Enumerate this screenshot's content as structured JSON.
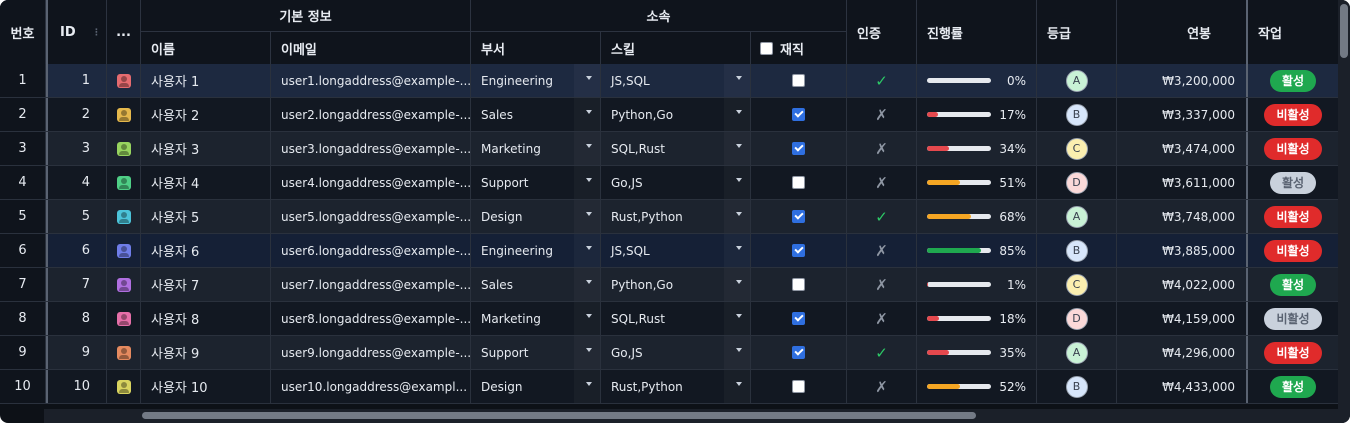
{
  "header": {
    "row_no": "번호",
    "id": "ID",
    "avatar": "...",
    "group_basic": "기본 정보",
    "name": "이름",
    "email": "이메일",
    "group_org": "소속",
    "dept": "부서",
    "skills": "스킬",
    "employed": "재직",
    "verified": "인증",
    "progress": "진행률",
    "grade": "등급",
    "salary": "연봉",
    "actions": "작업"
  },
  "colors": {
    "progress_low": "#e5484d",
    "progress_mid": "#f5a623",
    "progress_high": "#1fa84f",
    "badge_active": "#1fa84f",
    "badge_inactive": "#e02b2b",
    "badge_neutral": "#c9d1dc"
  },
  "rows": [
    {
      "no": "1",
      "id": "1",
      "avatar_color": "#e56b6f",
      "name": "사용자 1",
      "email": "user1.longaddress@example-...",
      "dept": "Engineering",
      "skills": "JS,SQL",
      "employed": false,
      "verified": true,
      "verified_mark": "✓",
      "progress": 0,
      "progress_label": "0%",
      "grade": "A",
      "grade_color": "#c9f2d6",
      "salary": "₩3,200,000",
      "status": "활성",
      "status_type": "active"
    },
    {
      "no": "2",
      "id": "2",
      "avatar_color": "#e5b84c",
      "name": "사용자 2",
      "email": "user2.longaddress@example-...",
      "dept": "Sales",
      "skills": "Python,Go",
      "employed": true,
      "verified": false,
      "verified_mark": "✗",
      "progress": 17,
      "progress_label": "17%",
      "grade": "B",
      "grade_color": "#d7e6fb",
      "salary": "₩3,337,000",
      "status": "비활성",
      "status_type": "inactive"
    },
    {
      "no": "3",
      "id": "3",
      "avatar_color": "#97d45f",
      "name": "사용자 3",
      "email": "user3.longaddress@example-...",
      "dept": "Marketing",
      "skills": "SQL,Rust",
      "employed": true,
      "verified": false,
      "verified_mark": "✗",
      "progress": 34,
      "progress_label": "34%",
      "grade": "C",
      "grade_color": "#fbefb0",
      "salary": "₩3,474,000",
      "status": "비활성",
      "status_type": "inactive"
    },
    {
      "no": "4",
      "id": "4",
      "avatar_color": "#4fcf86",
      "name": "사용자 4",
      "email": "user4.longaddress@example-...",
      "dept": "Support",
      "skills": "Go,JS",
      "employed": false,
      "verified": false,
      "verified_mark": "✗",
      "progress": 51,
      "progress_label": "51%",
      "grade": "D",
      "grade_color": "#fbd9d9",
      "salary": "₩3,611,000",
      "status": "활성",
      "status_type": "neutral"
    },
    {
      "no": "5",
      "id": "5",
      "avatar_color": "#4cc3d9",
      "name": "사용자 5",
      "email": "user5.longaddress@example-...",
      "dept": "Design",
      "skills": "Rust,Python",
      "employed": true,
      "verified": true,
      "verified_mark": "✓",
      "progress": 68,
      "progress_label": "68%",
      "grade": "A",
      "grade_color": "#c9f2d6",
      "salary": "₩3,748,000",
      "status": "비활성",
      "status_type": "inactive"
    },
    {
      "no": "6",
      "id": "6",
      "avatar_color": "#6f7de8",
      "name": "사용자 6",
      "email": "user6.longaddress@example-...",
      "dept": "Engineering",
      "skills": "JS,SQL",
      "employed": true,
      "verified": false,
      "verified_mark": "✗",
      "progress": 85,
      "progress_label": "85%",
      "grade": "B",
      "grade_color": "#d7e6fb",
      "salary": "₩3,885,000",
      "status": "비활성",
      "status_type": "inactive"
    },
    {
      "no": "7",
      "id": "7",
      "avatar_color": "#b06fe0",
      "name": "사용자 7",
      "email": "user7.longaddress@example-...",
      "dept": "Sales",
      "skills": "Python,Go",
      "employed": false,
      "verified": false,
      "verified_mark": "✗",
      "progress": 1,
      "progress_label": "1%",
      "grade": "C",
      "grade_color": "#fbefb0",
      "salary": "₩4,022,000",
      "status": "활성",
      "status_type": "active"
    },
    {
      "no": "8",
      "id": "8",
      "avatar_color": "#e56fa8",
      "name": "사용자 8",
      "email": "user8.longaddress@example-...",
      "dept": "Marketing",
      "skills": "SQL,Rust",
      "employed": true,
      "verified": false,
      "verified_mark": "✗",
      "progress": 18,
      "progress_label": "18%",
      "grade": "D",
      "grade_color": "#fbd9d9",
      "salary": "₩4,159,000",
      "status": "비활성",
      "status_type": "neutral"
    },
    {
      "no": "9",
      "id": "9",
      "avatar_color": "#e58a5f",
      "name": "사용자 9",
      "email": "user9.longaddress@example-...",
      "dept": "Support",
      "skills": "Go,JS",
      "employed": true,
      "verified": true,
      "verified_mark": "✓",
      "progress": 35,
      "progress_label": "35%",
      "grade": "A",
      "grade_color": "#c9f2d6",
      "salary": "₩4,296,000",
      "status": "비활성",
      "status_type": "inactive"
    },
    {
      "no": "10",
      "id": "10",
      "avatar_color": "#d9d45f",
      "name": "사용자 10",
      "email": "user10.longaddress@exampl...",
      "dept": "Design",
      "skills": "Rust,Python",
      "employed": false,
      "verified": false,
      "verified_mark": "✗",
      "progress": 52,
      "progress_label": "52%",
      "grade": "B",
      "grade_color": "#d7e6fb",
      "salary": "₩4,433,000",
      "status": "활성",
      "status_type": "active"
    }
  ]
}
